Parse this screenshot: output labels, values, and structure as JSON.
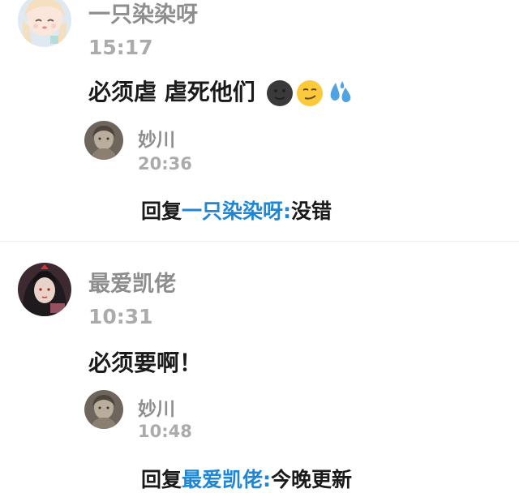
{
  "comments": [
    {
      "username": "一只染染呀",
      "time": "15:17",
      "text": "必须虐 虐死他们",
      "emojis": [
        "new-moon-face-icon",
        "smirk-face-icon",
        "sweat-droplets-icon"
      ],
      "reply": {
        "username": "妙川",
        "time": "20:36",
        "prefix": "回复",
        "mention": "一只染染呀",
        "colon": ":",
        "text": "没错"
      }
    },
    {
      "username": "最爱凯佬",
      "time": "10:31",
      "text": "必须要啊！",
      "reply": {
        "username": "妙川",
        "time": "10:48",
        "prefix": "回复",
        "mention": "最爱凯佬",
        "colon": ":",
        "text": "今晚更新"
      }
    }
  ],
  "colors": {
    "mention": "#1f86d6",
    "username": "#8e8e8e",
    "time": "#ababab",
    "text": "#1a1a1a"
  }
}
